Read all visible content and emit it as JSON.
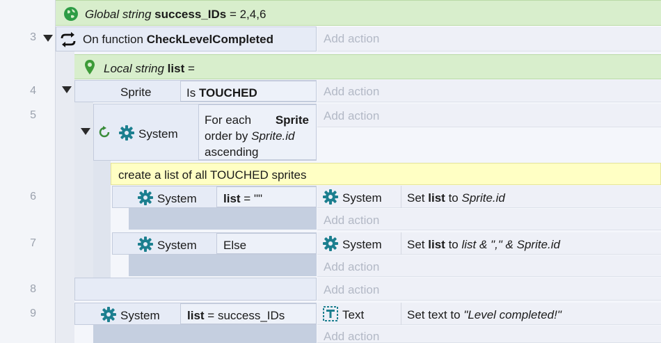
{
  "colors": {
    "gear": "#1c7f8f",
    "globe": "#2e9c45",
    "pin": "#3d9b38",
    "loop": "#3a8c3a",
    "text_icon": "#1c7f8f"
  },
  "icons": [
    "globe-icon",
    "refresh-icon",
    "pin-icon",
    "loop-icon",
    "gear-icon",
    "text-object-icon"
  ],
  "global_var": {
    "type_label": "Global string",
    "name": "success_IDs",
    "value": "= 2,4,6"
  },
  "function_event": {
    "line": "3",
    "prefix": "On function",
    "name": "CheckLevelCompleted",
    "add_action": "Add action"
  },
  "local_var": {
    "type_label": "Local string",
    "name": "list",
    "value": "="
  },
  "event4": {
    "line": "4",
    "object": "Sprite",
    "cond_prefix": "Is",
    "cond_bold": "TOUCHED",
    "add_action": "Add action"
  },
  "event5": {
    "line": "5",
    "object": "System",
    "line1_prefix": "For each",
    "line1_bold": "Sprite",
    "line2_prefix": "order by",
    "line2_italic": "Sprite.id",
    "line3": "ascending",
    "add_action": "Add action"
  },
  "comment": {
    "text": "create a list of all TOUCHED sprites"
  },
  "event6": {
    "line": "6",
    "object": "System",
    "cond_bold": "list",
    "cond_rest": "= \"\"",
    "action_object": "System",
    "action_prefix": "Set",
    "action_bold": "list",
    "action_mid": "to",
    "action_italic": "Sprite.id",
    "add_action": "Add action"
  },
  "event7": {
    "line": "7",
    "object": "System",
    "cond": "Else",
    "action_object": "System",
    "action_prefix": "Set",
    "action_bold": "list",
    "action_mid": "to",
    "action_italic": "list & \",\" & Sprite.id",
    "add_action": "Add action"
  },
  "event8": {
    "line": "8",
    "add_action": "Add action"
  },
  "event9": {
    "line": "9",
    "object": "System",
    "cond_bold": "list",
    "cond_rest": "= success_IDs",
    "action_object": "Text",
    "action_prefix": "Set text to",
    "action_italic": "\"Level completed!\"",
    "add_action": "Add action"
  }
}
